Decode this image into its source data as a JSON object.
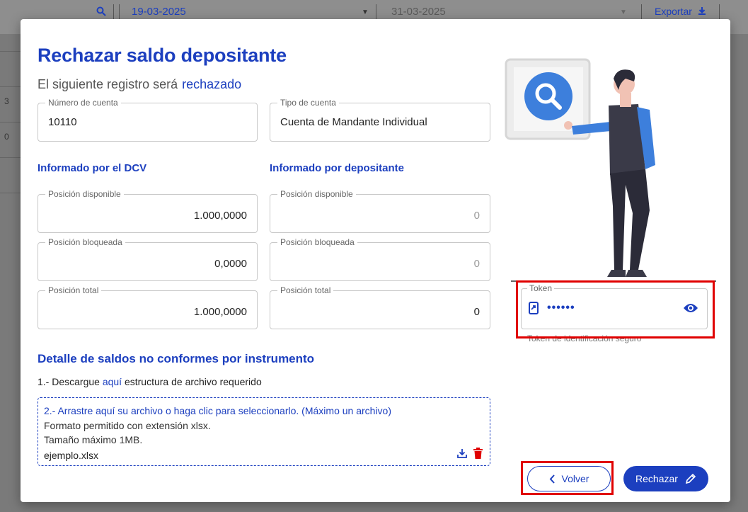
{
  "background": {
    "date_from": "19-03-2025",
    "date_to": "31-03-2025",
    "export_label": "Exportar",
    "left_marks": [
      "3",
      "0"
    ]
  },
  "modal": {
    "title": "Rechazar saldo depositante",
    "subtitle": "El siguiente registro será",
    "subtitle_accent": "rechazado",
    "account_number": {
      "label": "Número de cuenta",
      "value": "10110"
    },
    "account_type": {
      "label": "Tipo de cuenta",
      "value": "Cuenta de Mandante Individual"
    },
    "dcv": {
      "heading": "Informado por el DCV",
      "disponible": {
        "label": "Posición disponible",
        "value": "1.000,0000"
      },
      "bloqueada": {
        "label": "Posición bloqueada",
        "value": "0,0000"
      },
      "total": {
        "label": "Posición total",
        "value": "1.000,0000"
      }
    },
    "depositante": {
      "heading": "Informado por depositante",
      "disponible": {
        "label": "Posición disponible",
        "value": "0"
      },
      "bloqueada": {
        "label": "Posición bloqueada",
        "value": "0"
      },
      "total": {
        "label": "Posición total",
        "value": "0"
      }
    },
    "detail": {
      "heading": "Detalle de saldos no conformes por instrumento",
      "step1_prefix": "1.- Descargue",
      "step1_link": "aquí",
      "step1_suffix": "estructura de archivo requerido",
      "dropzone_title": "2.- Arrastre aquí su archivo o haga clic para seleccionarlo. (Máximo un archivo)",
      "format_line": "Formato permitido con extensión xlsx.",
      "size_line": "Tamaño máximo 1MB.",
      "file_name": "ejemplo.xlsx"
    },
    "token": {
      "label": "Token",
      "value": "••••••",
      "helper": "Token de identificación seguro"
    },
    "buttons": {
      "back": "Volver",
      "reject": "Rechazar"
    }
  },
  "colors": {
    "accent": "#1c3fbf",
    "danger": "#e00000",
    "highlight": "#e00000"
  }
}
